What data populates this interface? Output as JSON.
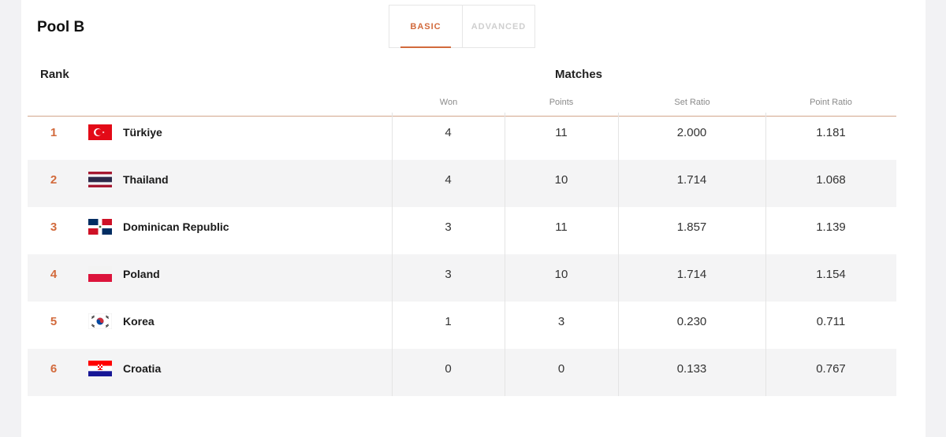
{
  "pool_title": "Pool B",
  "tabs": [
    {
      "label": "BASIC",
      "active": true
    },
    {
      "label": "ADVANCED",
      "active": false
    }
  ],
  "headers": {
    "rank": "Rank",
    "matches": "Matches",
    "won": "Won",
    "points": "Points",
    "set_ratio": "Set Ratio",
    "point_ratio": "Point Ratio"
  },
  "accent_color": "#d26a3c",
  "rows": [
    {
      "rank": "1",
      "country": "Türkiye",
      "flag": "turkey-flag-icon",
      "won": "4",
      "points": "11",
      "set_ratio": "2.000",
      "point_ratio": "1.181"
    },
    {
      "rank": "2",
      "country": "Thailand",
      "flag": "thailand-flag-icon",
      "won": "4",
      "points": "10",
      "set_ratio": "1.714",
      "point_ratio": "1.068"
    },
    {
      "rank": "3",
      "country": "Dominican Republic",
      "flag": "dominican-republic-flag-icon",
      "won": "3",
      "points": "11",
      "set_ratio": "1.857",
      "point_ratio": "1.139"
    },
    {
      "rank": "4",
      "country": "Poland",
      "flag": "poland-flag-icon",
      "won": "3",
      "points": "10",
      "set_ratio": "1.714",
      "point_ratio": "1.154"
    },
    {
      "rank": "5",
      "country": "Korea",
      "flag": "korea-flag-icon",
      "won": "1",
      "points": "3",
      "set_ratio": "0.230",
      "point_ratio": "0.711"
    },
    {
      "rank": "6",
      "country": "Croatia",
      "flag": "croatia-flag-icon",
      "won": "0",
      "points": "0",
      "set_ratio": "0.133",
      "point_ratio": "0.767"
    }
  ]
}
